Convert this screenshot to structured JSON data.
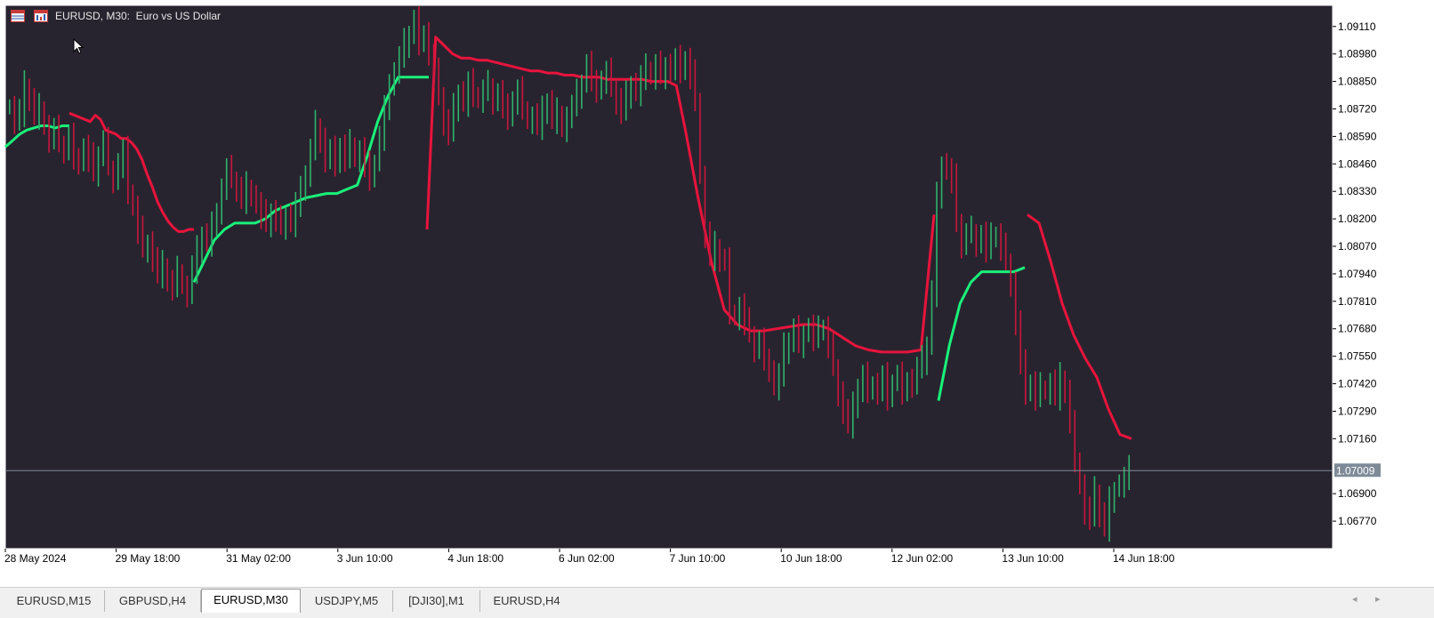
{
  "window": {
    "title": "EURUSD, M30:  Euro vs US Dollar"
  },
  "icons": {
    "title_icon_1": "table-icon",
    "title_icon_2": "chart-icon",
    "cursor": "mouse-pointer-icon"
  },
  "colors": {
    "background": "#28242f",
    "frame": "#ffffff",
    "bull_candle": "#2fb36c",
    "bear_candle": "#c8163d",
    "upper_band": "#e8143c",
    "lower_band": "#19f27a",
    "grid_text": "#000000",
    "price_line": "#7e8a97",
    "current_price_bg": "#7e8a97"
  },
  "chart_data": {
    "type": "line",
    "description_series": [
      {
        "name": "",
        "color": "#e8143c",
        "segment": "resistance"
      },
      {
        "name": "",
        "color": "#19f27a",
        "segment": "support"
      }
    ],
    "ylim": [
      1.0664,
      1.0921
    ],
    "price_ticks": [
      "1.09110",
      "1.08980",
      "1.08850",
      "1.08720",
      "1.08590",
      "1.08460",
      "1.08330",
      "1.08200",
      "1.08070",
      "1.07940",
      "1.07810",
      "1.07680",
      "1.07550",
      "1.07420",
      "1.07290",
      "1.07160",
      "1.06900",
      "1.06770"
    ],
    "current_price": "1.07009",
    "time_ticks": [
      "28 May 2024",
      "29 May 18:00",
      "31 May 02:00",
      "3 Jun 10:00",
      "4 Jun 18:00",
      "6 Jun 02:00",
      "7 Jun 10:00",
      "10 Jun 18:00",
      "12 Jun 02:00",
      "13 Jun 10:00",
      "14 Jun 18:00"
    ],
    "close_series": [
      1.0873,
      1.0866,
      1.087,
      1.0882,
      1.0876,
      1.0868,
      1.0872,
      1.0864,
      1.0858,
      1.0861,
      1.0855,
      1.0852,
      1.0858,
      1.085,
      1.0846,
      1.0853,
      1.0848,
      1.0842,
      1.085,
      1.0856,
      1.0844,
      1.0838,
      1.0846,
      1.0851,
      1.0832,
      1.0825,
      1.0814,
      1.0806,
      1.0809,
      1.08,
      1.0793,
      1.0797,
      1.079,
      1.0788,
      1.0795,
      1.0788,
      1.0784,
      1.0796,
      1.0804,
      1.0812,
      1.0808,
      1.0816,
      1.0824,
      1.0834,
      1.0842,
      1.0838,
      1.0834,
      1.0829,
      1.0835,
      1.0831,
      1.0826,
      1.0821,
      1.0818,
      1.0823,
      1.0819,
      1.0816,
      1.0822,
      1.0818,
      1.0826,
      1.0832,
      1.0841,
      1.0852,
      1.0864,
      1.0858,
      1.0847,
      1.0851,
      1.0846,
      1.0854,
      1.0849,
      1.0855,
      1.0848,
      1.0852,
      1.0844,
      1.084,
      1.0846,
      1.0858,
      1.0871,
      1.0885,
      1.0889,
      1.0895,
      1.0902,
      1.0907,
      1.0913,
      1.0904,
      1.0908,
      1.0896,
      1.0888,
      1.0878,
      1.0866,
      1.086,
      1.0872,
      1.088,
      1.0875,
      1.0883,
      1.0878,
      1.0876,
      1.088,
      1.0883,
      1.0876,
      1.0879,
      1.0871,
      1.0868,
      1.0876,
      1.088,
      1.0872,
      1.0866,
      1.0868,
      1.0864,
      1.087,
      1.0875,
      1.0866,
      1.087,
      1.0863,
      1.0868,
      1.0872,
      1.0878,
      1.0884,
      1.0892,
      1.0887,
      1.088,
      1.0885,
      1.0888,
      1.0882,
      1.0876,
      1.087,
      1.0878,
      1.0884,
      1.088,
      1.0886,
      1.089,
      1.0887,
      1.0892,
      1.0888,
      1.0893,
      1.0889,
      1.0894,
      1.089,
      1.0895,
      1.0888,
      1.0876,
      1.084,
      1.0812,
      1.0802,
      1.0806,
      1.08,
      1.0799,
      1.0776,
      1.0774,
      1.0778,
      1.077,
      1.0765,
      1.0758,
      1.0761,
      1.0755,
      1.0748,
      1.074,
      1.0745,
      1.0758,
      1.0762,
      1.0767,
      1.076,
      1.0766,
      1.0768,
      1.0764,
      1.0766,
      1.0768,
      1.076,
      1.075,
      1.0738,
      1.0728,
      1.0722,
      1.073,
      1.074,
      1.0745,
      1.0738,
      1.0742,
      1.0738,
      1.0744,
      1.0736,
      1.0742,
      1.0745,
      1.0738,
      1.0744,
      1.0742,
      1.0748,
      1.0752,
      1.076,
      1.0785,
      1.083,
      1.0846,
      1.0842,
      1.0838,
      1.0818,
      1.0808,
      1.0812,
      1.0814,
      1.0808,
      1.0812,
      1.0806,
      1.081,
      1.0812,
      1.0806,
      1.08,
      1.079,
      1.077,
      1.075,
      1.0738,
      1.0742,
      1.0736,
      1.074,
      1.0738,
      1.0742,
      1.0736,
      1.0744,
      1.0738,
      1.0722,
      1.0706,
      1.0694,
      1.0682,
      1.0678,
      1.069,
      1.068,
      1.0674,
      1.0686,
      1.0692,
      1.0694,
      1.0696,
      1.07
    ],
    "band_upper": [
      1.087,
      1.0869,
      1.0868,
      1.0867,
      1.0866,
      1.0869,
      1.0867,
      1.0862,
      1.0861,
      1.086,
      1.0858,
      1.0858,
      1.0856,
      1.0853,
      1.0848,
      1.0841,
      1.0835,
      1.0828,
      1.0823,
      1.0819,
      1.0816,
      1.0814,
      1.0814,
      1.0815,
      1.0815,
      1.0906,
      1.0902,
      1.0898,
      1.0896,
      1.0896,
      1.0895,
      1.0895,
      1.0894,
      1.0893,
      1.0892,
      1.0891,
      1.089,
      1.089,
      1.0889,
      1.0889,
      1.0888,
      1.0888,
      1.0887,
      1.0887,
      1.0887,
      1.0886,
      1.0886,
      1.0886,
      1.0886,
      1.0886,
      1.0885,
      1.0885,
      1.0885,
      1.0883,
      1.0863,
      1.083,
      1.08,
      1.0777,
      1.077,
      1.0767,
      1.0767,
      1.0768,
      1.0769,
      1.077,
      1.077,
      1.0768,
      1.0764,
      1.076,
      1.0758,
      1.0757,
      1.0757,
      1.0757,
      1.0758,
      1.0822,
      1.0818,
      1.08,
      1.078,
      1.0765,
      1.0754,
      1.0745,
      1.073,
      1.0718,
      1.0716
    ],
    "band_lower": [
      1.0854,
      1.0857,
      1.086,
      1.0862,
      1.0863,
      1.0864,
      1.0864,
      1.0863,
      1.0864,
      1.0864,
      1.079,
      1.08,
      1.081,
      1.0815,
      1.0818,
      1.0818,
      1.0818,
      1.082,
      1.0824,
      1.0826,
      1.0828,
      1.083,
      1.0831,
      1.0832,
      1.0832,
      1.0834,
      1.0836,
      1.085,
      1.0866,
      1.0878,
      1.0887,
      1.0887,
      1.0887,
      1.0887,
      1.0734,
      1.076,
      1.078,
      1.079,
      1.0795,
      1.0795,
      1.0795,
      1.0795,
      1.0797
    ]
  },
  "tabs": [
    {
      "label": "EURUSD,M15"
    },
    {
      "label": "GBPUSD,H4"
    },
    {
      "label": "EURUSD,M30"
    },
    {
      "label": "USDJPY,M5"
    },
    {
      "label": "[DJI30],M1"
    },
    {
      "label": "EURUSD,H4"
    }
  ],
  "active_tab": "EURUSD,M30",
  "scroll": {
    "left_arrow": "◂",
    "right_arrow": "▸"
  }
}
